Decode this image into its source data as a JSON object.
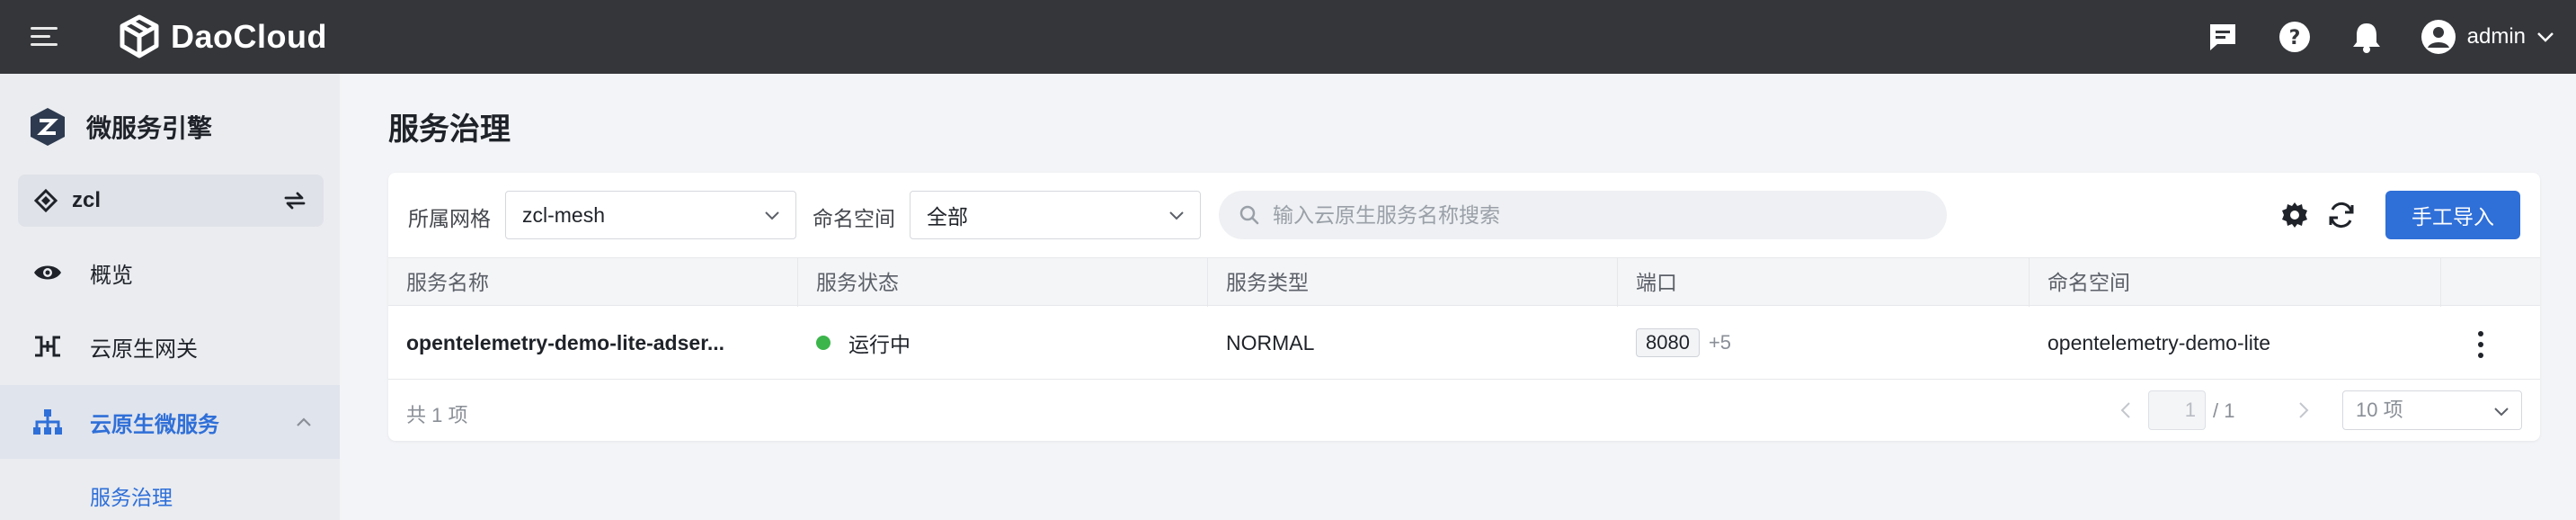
{
  "topbar": {
    "brand": "DaoCloud",
    "username": "admin",
    "icons": [
      "menu-icon",
      "message-icon",
      "help-icon",
      "bell-icon",
      "user-avatar-icon",
      "chevron-down-icon"
    ]
  },
  "sidebar": {
    "product_title": "微服务引擎",
    "workspace": "zcl",
    "items": [
      {
        "label": "概览",
        "icon": "eye-icon"
      },
      {
        "label": "云原生网关",
        "icon": "gateway-icon"
      },
      {
        "label": "云原生微服务",
        "icon": "hierarchy-icon",
        "active": true
      }
    ],
    "sub_item": "服务治理"
  },
  "main": {
    "page_title": "服务治理",
    "filters": {
      "mesh_label": "所属网格",
      "mesh_value": "zcl-mesh",
      "namespace_label": "命名空间",
      "namespace_value": "全部",
      "search_placeholder": "输入云原生服务名称搜索"
    },
    "import_button": "手工导入",
    "table": {
      "columns": [
        "服务名称",
        "服务状态",
        "服务类型",
        "端口",
        "命名空间"
      ],
      "rows": [
        {
          "name": "opentelemetry-demo-lite-adser...",
          "status": "运行中",
          "type": "NORMAL",
          "port": "8080",
          "port_more": "+5",
          "namespace": "opentelemetry-demo-lite"
        }
      ]
    },
    "pagination": {
      "total": "共 1 项",
      "current": "1",
      "of_total": "/ 1",
      "page_size": "10 项"
    }
  },
  "colors": {
    "topbar": "#34363a",
    "primary": "#2f6fd8",
    "running": "#3cb54b"
  }
}
